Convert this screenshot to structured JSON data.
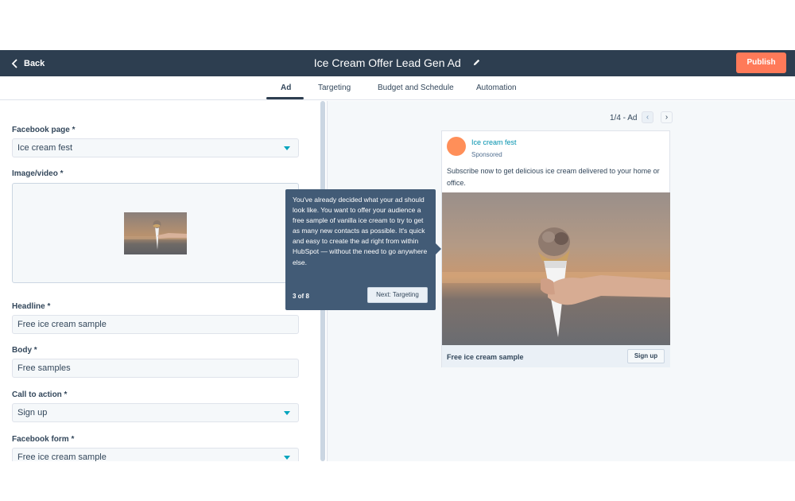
{
  "header": {
    "back_label": "Back",
    "title": "Ice Cream Offer Lead Gen Ad",
    "publish_label": "Publish"
  },
  "tabs": [
    {
      "label": "Ad",
      "active": true
    },
    {
      "label": "Targeting",
      "active": false
    },
    {
      "label": "Budget and Schedule",
      "active": false
    },
    {
      "label": "Automation",
      "active": false
    }
  ],
  "form": {
    "facebook_page": {
      "label": "Facebook page *",
      "value": "Ice cream fest"
    },
    "image_video": {
      "label": "Image/video *"
    },
    "headline": {
      "label": "Headline *",
      "value": "Free ice cream sample"
    },
    "body": {
      "label": "Body *",
      "value": "Free samples"
    },
    "call_to_action": {
      "label": "Call to action *",
      "value": "Sign up"
    },
    "facebook_form": {
      "label": "Facebook form *",
      "value": "Free ice cream sample"
    }
  },
  "preview": {
    "pager_label": "1/4 - Ad",
    "prev_icon": "chevron-left-icon",
    "next_icon": "chevron-right-icon",
    "page_name": "Ice cream fest",
    "sponsored": "Sponsored",
    "text": "Subscribe now to get delicious ice cream delivered to your home or office.",
    "footer_headline": "Free ice cream sample",
    "cta_label": "Sign up"
  },
  "tooltip": {
    "text": "You've already decided what your ad should look like. You want to offer your audience a free sample of vanilla ice cream to try to get as many new contacts as possible. It's quick and easy to create the ad right from within HubSpot — without the need to go anywhere else.",
    "step": "3 of 8",
    "next_label": "Next: Targeting"
  },
  "colors": {
    "topbar": "#2d3e50",
    "publish": "#ff7a59",
    "link": "#0091ae",
    "caret": "#00a4bd",
    "tooltip": "#425b76"
  }
}
